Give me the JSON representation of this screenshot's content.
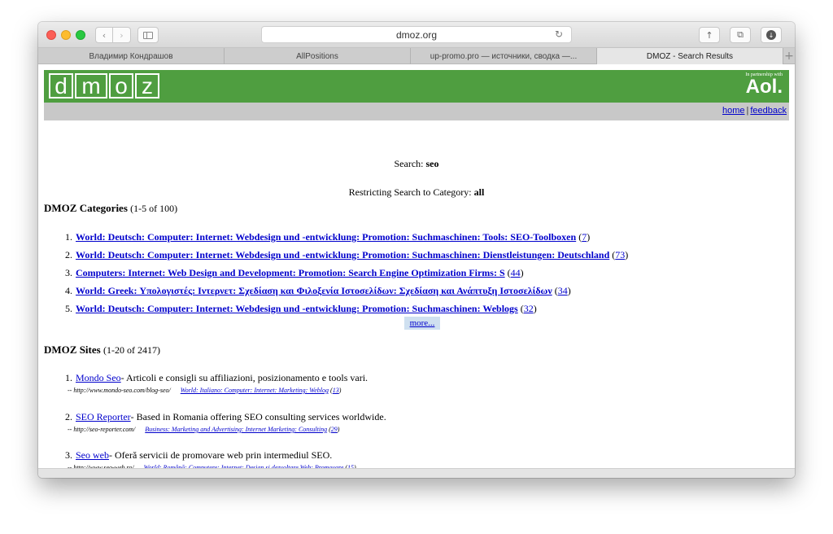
{
  "browser": {
    "address": "dmoz.org",
    "tabs": [
      {
        "label": "Владимир Кондрашов"
      },
      {
        "label": "AllPositions"
      },
      {
        "label": "up-promo.pro — источники, сводка —..."
      },
      {
        "label": "DMOZ - Search Results"
      }
    ],
    "icons": {
      "back": "chevron-left-icon",
      "forward": "chevron-right-icon",
      "sidebar": "sidebar-icon",
      "reload": "reload-icon",
      "share": "share-icon",
      "tabs": "tabs-icon",
      "download": "download-icon",
      "new_tab": "plus-icon"
    }
  },
  "header": {
    "logo_letters": [
      "d",
      "m",
      "o",
      "z"
    ],
    "partner_small": "In partnership with",
    "partner_brand": "Aol.",
    "links": {
      "home": "home",
      "sep": "|",
      "feedback": "feedback"
    },
    "colors": {
      "green": "#4f9e40",
      "gray": "#c8c8c8"
    }
  },
  "search": {
    "label": "Search:",
    "query": "seo",
    "restrict_label": "Restricting Search to Category:",
    "restrict_value": "all"
  },
  "categories": {
    "title": "DMOZ Categories",
    "count": "(1-5 of 100)",
    "items": [
      {
        "num": "1.",
        "label": "World: Deutsch: Computer: Internet: Webdesign und -entwicklung: Promotion: Suchmaschinen: Tools: SEO-Toolboxen",
        "count": "7"
      },
      {
        "num": "2.",
        "label": "World: Deutsch: Computer: Internet: Webdesign und -entwicklung: Promotion: Suchmaschinen: Dienstleistungen: Deutschland",
        "count": "73"
      },
      {
        "num": "3.",
        "label": "Computers: Internet: Web Design and Development: Promotion: Search Engine Optimization Firms: S",
        "count": "44"
      },
      {
        "num": "4.",
        "label": "World: Greek: Υπολογιστές: Ιντερνετ: Σχεδίαση και Φιλοξενία Ιστοσελίδων: Σχεδίαση και Ανάπτυξη Ιστοσελίδων",
        "count": "34"
      },
      {
        "num": "5.",
        "label": "World: Deutsch: Computer: Internet: Webdesign und -entwicklung: Promotion: Suchmaschinen: Weblogs",
        "count": "32"
      }
    ],
    "more": "more..."
  },
  "sites": {
    "title": "DMOZ Sites",
    "count": "(1-20 of 2417)",
    "items": [
      {
        "num": "1.",
        "name": "Mondo Seo",
        "desc": " - Articoli e consigli su affiliazioni, posizionamento e tools vari.",
        "url": "-- http://www.mondo-seo.com/blog-seo/",
        "category": "World: Italiano: Computer: Internet: Marketing: Weblog",
        "cat_count": "13"
      },
      {
        "num": "2.",
        "name": "SEO Reporter",
        "desc": " - Based in Romania offering SEO consulting services worldwide.",
        "url": "-- http://seo-reporter.com/",
        "category": "Business: Marketing and Advertising: Internet Marketing: Consulting",
        "cat_count": "29"
      },
      {
        "num": "3.",
        "name": "Seo web",
        "desc": " - Oferă servicii de promovare web prin intermediul SEO.",
        "url": "-- http://www.seo-web.ro/",
        "category": "World: Română: Computere: Internet: Design și dezvoltare Web: Promovare",
        "cat_count": "15"
      }
    ]
  }
}
